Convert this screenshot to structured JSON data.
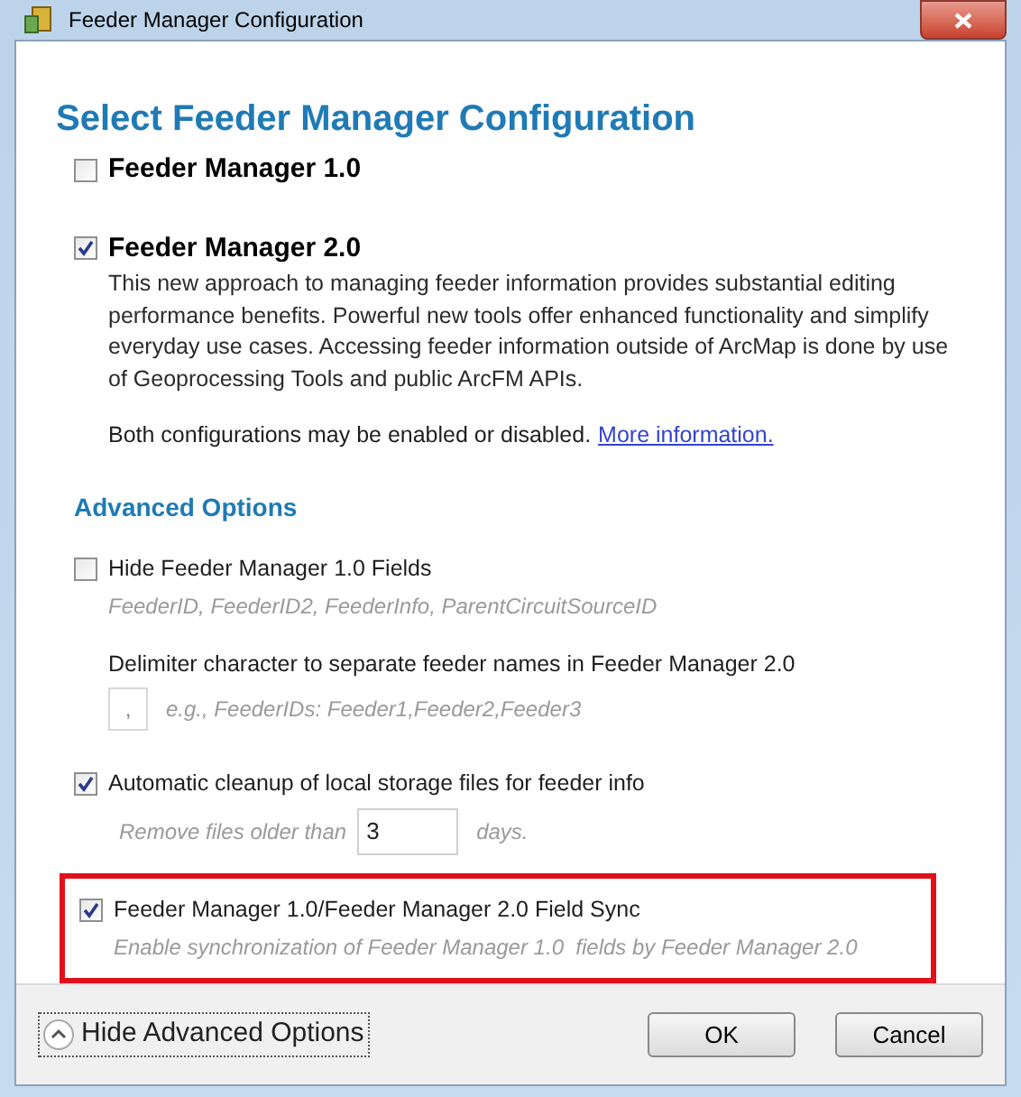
{
  "window": {
    "title": "Feeder Manager Configuration"
  },
  "heading": "Select Feeder Manager Configuration",
  "configurations": [
    {
      "label": "Feeder Manager 1.0",
      "checked": false
    },
    {
      "label": "Feeder Manager 2.0",
      "checked": true,
      "description": "This new approach to managing feeder information provides substantial editing performance benefits. Powerful new tools offer enhanced functionality and simplify everyday use cases. Accessing feeder information outside of ArcMap is done by use of Geoprocessing Tools and public ArcFM APIs."
    }
  ],
  "note": {
    "text": "Both configurations may be enabled or disabled.",
    "link": "More information."
  },
  "advanced": {
    "title": "Advanced Options",
    "options": [
      {
        "kind": "checkbox",
        "label": "Hide Feeder Manager 1.0 Fields",
        "checked": false,
        "hint": "FeederID, FeederID2, FeederInfo, ParentCircuitSourceID",
        "highlighted": false
      },
      {
        "kind": "delimiter",
        "label": "Delimiter character to separate feeder names in Feeder Manager 2.0",
        "value": ",",
        "hint": "e.g., FeederIDs: Feeder1,Feeder2,Feeder3"
      },
      {
        "kind": "checkbox",
        "label": "Automatic cleanup of local storage files for feeder info",
        "checked": true,
        "retention": {
          "prefix": "Remove files older than",
          "value": "3",
          "suffix": "days."
        },
        "highlighted": false
      },
      {
        "kind": "checkbox",
        "label": "Feeder Manager 1.0/Feeder Manager 2.0 Field Sync",
        "checked": true,
        "hint": "Enable synchronization of Feeder Manager 1.0  fields by Feeder Manager 2.0",
        "highlighted": true
      }
    ]
  },
  "footer": {
    "toggle": "Hide Advanced Options",
    "expanded": true,
    "buttons": [
      {
        "label": "OK"
      },
      {
        "label": "Cancel"
      }
    ]
  }
}
